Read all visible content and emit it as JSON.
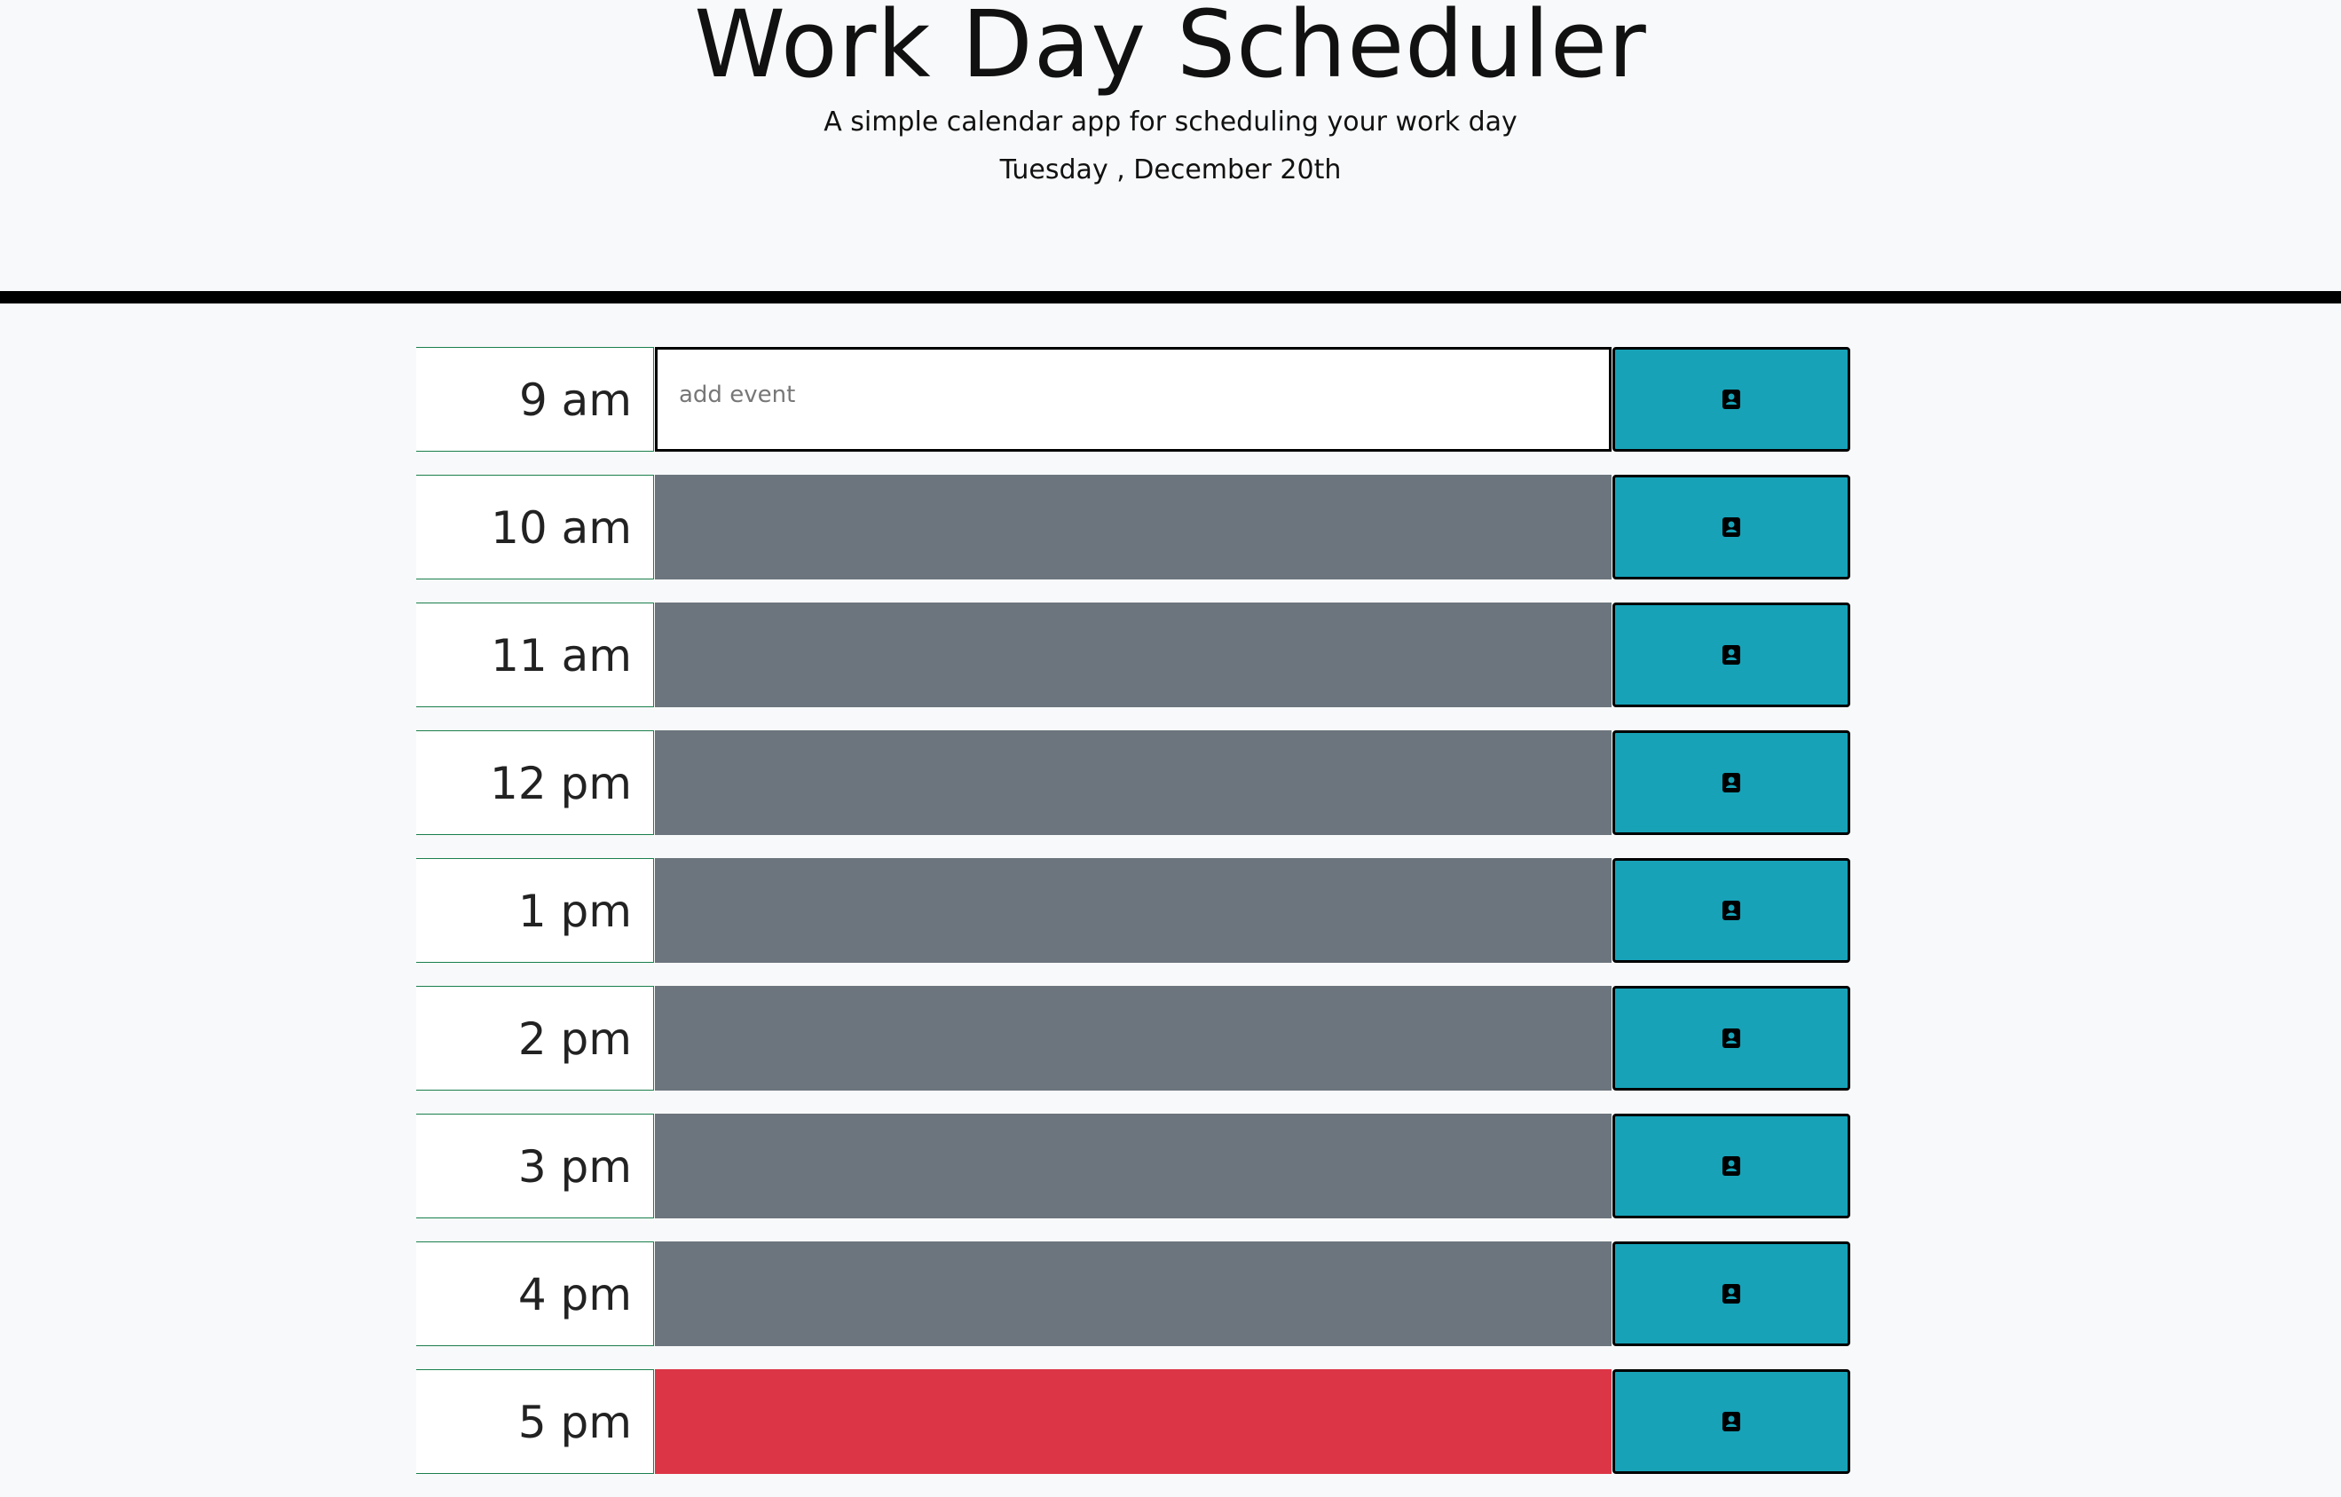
{
  "header": {
    "title": "Work Day Scheduler",
    "subtitle": "A simple calendar app for scheduling your work day",
    "date": "Tuesday , December 20th"
  },
  "rows": [
    {
      "hour": "9 am",
      "placeholder": "add event",
      "value": "",
      "state": "present"
    },
    {
      "hour": "10 am",
      "placeholder": "",
      "value": "",
      "state": "past"
    },
    {
      "hour": "11 am",
      "placeholder": "",
      "value": "",
      "state": "past"
    },
    {
      "hour": "12 pm",
      "placeholder": "",
      "value": "",
      "state": "past"
    },
    {
      "hour": "1 pm",
      "placeholder": "",
      "value": "",
      "state": "past"
    },
    {
      "hour": "2 pm",
      "placeholder": "",
      "value": "",
      "state": "past"
    },
    {
      "hour": "3 pm",
      "placeholder": "",
      "value": "",
      "state": "past"
    },
    {
      "hour": "4 pm",
      "placeholder": "",
      "value": "",
      "state": "past"
    },
    {
      "hour": "5 pm",
      "placeholder": "",
      "value": "",
      "state": "highlight"
    }
  ],
  "colors": {
    "past": "#6c757d",
    "present": "#ffffff",
    "highlight": "#dc3545",
    "save_button": "#17a2b8",
    "divider": "#000000"
  },
  "icons": {
    "save": "address-book-icon"
  }
}
